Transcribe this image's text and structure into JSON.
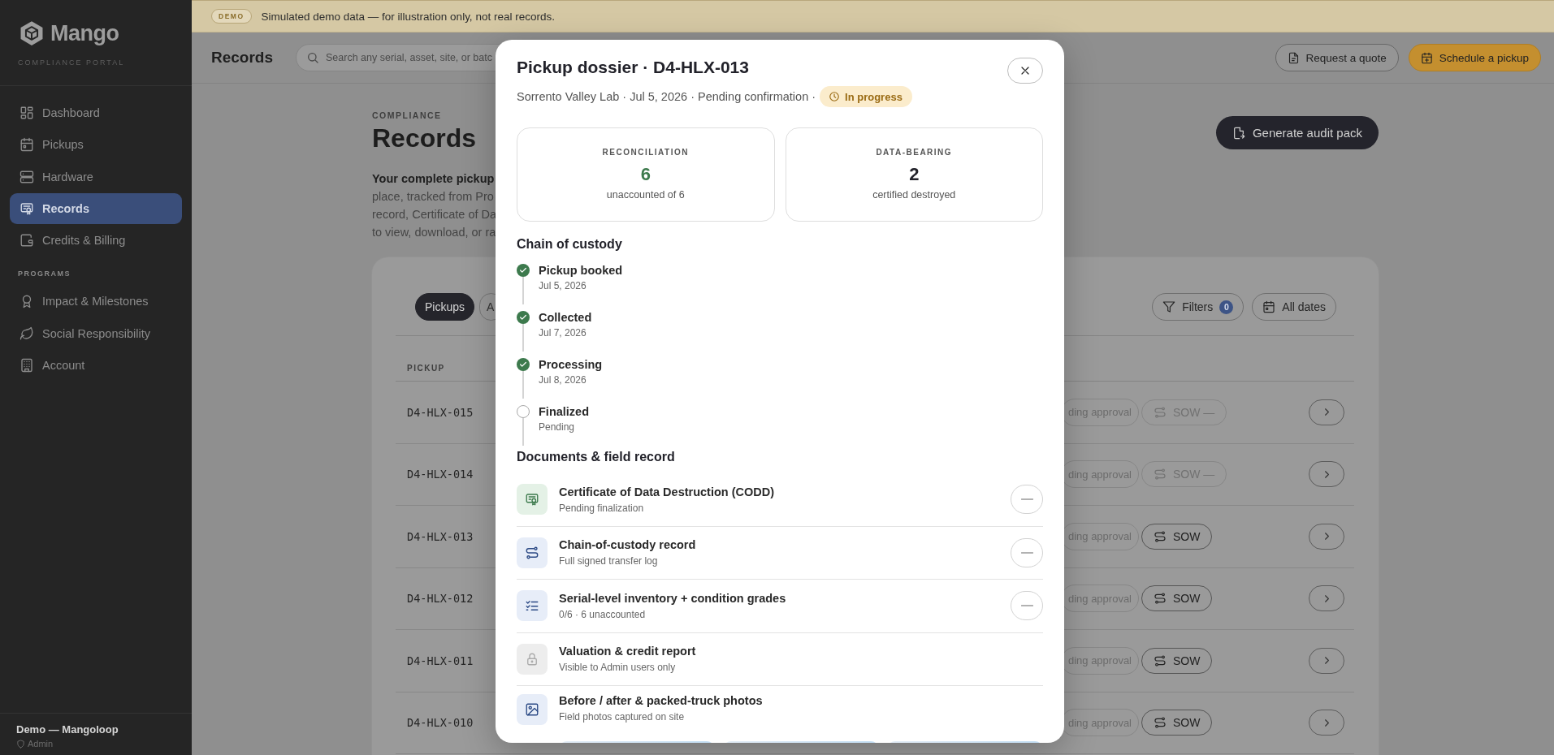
{
  "banner": {
    "badge": "DEMO",
    "text": "Simulated demo data — for illustration only, not real records."
  },
  "sidebar": {
    "brand": "Mango",
    "tagline": "COMPLIANCE PORTAL",
    "sections": [
      {
        "items": [
          {
            "label": "Dashboard",
            "selected": false
          },
          {
            "label": "Pickups",
            "selected": false
          },
          {
            "label": "Hardware",
            "selected": false
          },
          {
            "label": "Records",
            "selected": true
          },
          {
            "label": "Credits & Billing",
            "selected": false
          }
        ]
      },
      {
        "title": "PROGRAMS",
        "items": [
          {
            "label": "Impact & Milestones",
            "selected": false
          },
          {
            "label": "Social Responsibility",
            "selected": false
          },
          {
            "label": "Account",
            "selected": false
          }
        ]
      }
    ],
    "footer": {
      "org": "Demo — Mangoloop",
      "role": "Admin"
    }
  },
  "header": {
    "title": "Records",
    "search": {
      "placeholder": "Search any serial, asset, site, or batc"
    },
    "buttons": [
      {
        "label": "Request a quote",
        "kind": "secondary"
      },
      {
        "label": "Schedule a pickup",
        "kind": "primary"
      }
    ]
  },
  "page": {
    "eyebrow": "COMPLIANCE",
    "title": "Records",
    "action": "Generate audit pack",
    "intro_lines": [
      "Your complete pickup",
      "place, tracked from Pro",
      "record, Certificate of Da",
      "to view, download, or ra"
    ],
    "tabs": [
      {
        "label": "Pickups",
        "selected": true
      },
      {
        "label": "A",
        "selected": false
      }
    ],
    "filters": {
      "label": "Filters",
      "count": "0"
    },
    "date_filter": "All dates",
    "table": {
      "columns": [
        "PICKUP"
      ],
      "rows": [
        {
          "pickup": "D4-HLX-015",
          "status": "ding approval",
          "sow": {
            "label": "SOW —",
            "available": false
          }
        },
        {
          "pickup": "D4-HLX-014",
          "status": "ding approval",
          "sow": {
            "label": "SOW —",
            "available": false
          }
        },
        {
          "pickup": "D4-HLX-013",
          "status": "ding approval",
          "sow": {
            "label": "SOW",
            "available": true
          }
        },
        {
          "pickup": "D4-HLX-012",
          "status": "ding approval",
          "sow": {
            "label": "SOW",
            "available": true
          }
        },
        {
          "pickup": "D4-HLX-011",
          "status": "ding approval",
          "sow": {
            "label": "SOW",
            "available": true
          }
        },
        {
          "pickup": "D4-HLX-010",
          "status": "ding approval",
          "sow": {
            "label": "SOW",
            "available": true
          }
        }
      ]
    }
  },
  "modal": {
    "title": "Pickup dossier · D4-HLX-013",
    "subtitle": "Sorrento Valley Lab · Jul 5, 2026 · Pending confirmation ·",
    "status": "In progress",
    "stats": [
      {
        "label": "RECONCILIATION",
        "value": "6",
        "caption": "unaccounted of 6",
        "color": "#3d7a4d"
      },
      {
        "label": "DATA-BEARING",
        "value": "2",
        "caption": "certified destroyed",
        "color": "#22222a"
      }
    ],
    "custody": {
      "title": "Chain of custody",
      "steps": [
        {
          "label": "Pickup booked",
          "date": "Jul 5, 2026",
          "done": true
        },
        {
          "label": "Collected",
          "date": "Jul 7, 2026",
          "done": true
        },
        {
          "label": "Processing",
          "date": "Jul 8, 2026",
          "done": true
        },
        {
          "label": "Finalized",
          "date": "Pending",
          "done": false
        }
      ]
    },
    "documents": {
      "title": "Documents & field record",
      "items": [
        {
          "title": "Certificate of Data Destruction (CODD)",
          "detail": "Pending finalization",
          "kind": "file",
          "color": "#e4f1e6"
        },
        {
          "title": "Chain-of-custody record",
          "detail": "Full signed transfer log",
          "kind": "file",
          "color": "#e7edf8"
        },
        {
          "title": "Serial-level inventory + condition grades",
          "detail": "0/6 · 6 unaccounted",
          "kind": "file",
          "color": "#e7edf8"
        },
        {
          "title": "Valuation & credit report",
          "detail": "Visible to Admin users only",
          "kind": "locked",
          "color": "#ededed"
        },
        {
          "title": "Before / after & packed-truck photos",
          "detail": "Field photos captured on site",
          "kind": "gallery",
          "color": "#e7edf8"
        }
      ]
    }
  }
}
